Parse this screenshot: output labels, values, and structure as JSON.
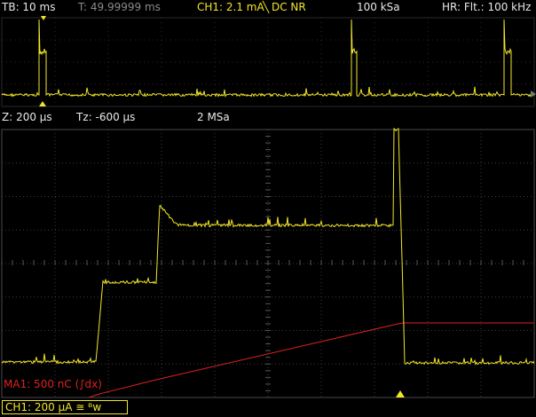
{
  "top_bar": {
    "timebase": "TB: 10 ms",
    "trigger_time": "T: 49.99999 ms",
    "channel": "CH1: 2.1 mA",
    "coupling": "DC NR",
    "sample_rate": "100 kSa",
    "filter": "HR: Flt.: 100 kHz"
  },
  "zoom_bar": {
    "zoom": "Z: 200 µs",
    "zoom_time": "Tz: -600 µs",
    "sample_rate": "2 MSa"
  },
  "math": {
    "label": "MA1: 500 nC (∫dx)"
  },
  "bottom_bar": {
    "channel_scale": "CH1: 200 µA ≅ ᴮᴡ"
  },
  "colors": {
    "trace": "#f2e62a",
    "math": "#e02020",
    "grid": "#3c3c3c"
  },
  "icons": {
    "slope": "falling-edge-icon",
    "trigger_marker": "triangle-icon"
  }
}
